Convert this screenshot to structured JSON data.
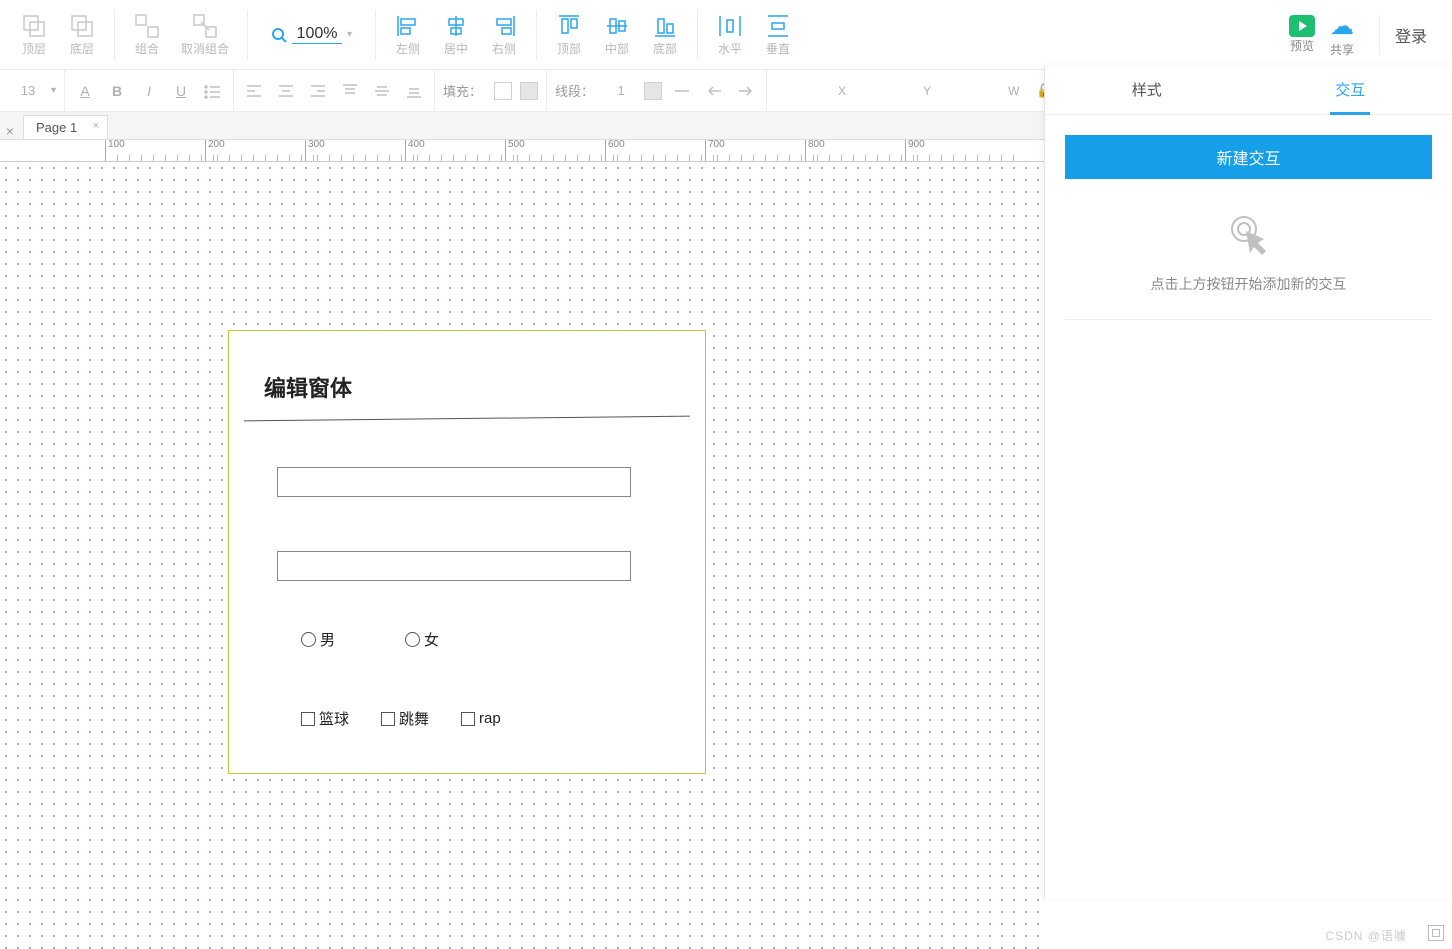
{
  "toolbar1": {
    "layer_top": "顶层",
    "layer_bottom": "底层",
    "group": "组合",
    "ungroup": "取消组合",
    "align_left": "左侧",
    "align_center": "居中",
    "align_right": "右侧",
    "align_top": "顶部",
    "align_middle": "中部",
    "align_bottom": "底部",
    "dist_h": "水平",
    "dist_v": "垂直",
    "preview": "预览",
    "share": "共享",
    "login": "登录",
    "zoom": "100%"
  },
  "toolbar2": {
    "font_size": "13",
    "fill_label": "填充：",
    "line_label": "线段：",
    "line_width": "1",
    "x": "",
    "y": "",
    "w": "",
    "x_label": "X",
    "y_label": "Y",
    "w_label": "W"
  },
  "tab": {
    "name": "Page 1"
  },
  "ruler": [
    100,
    200,
    300,
    400,
    500,
    600,
    700,
    800,
    900
  ],
  "shape": {
    "title": "编辑窗体",
    "radio1": "男",
    "radio2": "女",
    "check1": "篮球",
    "check2": "跳舞",
    "check3": "rap"
  },
  "side": {
    "tab_style": "样式",
    "tab_inter": "交互",
    "new_btn": "新建交互",
    "hint": "点击上方按钮开始添加新的交互"
  },
  "watermark": "CSDN @语噱"
}
